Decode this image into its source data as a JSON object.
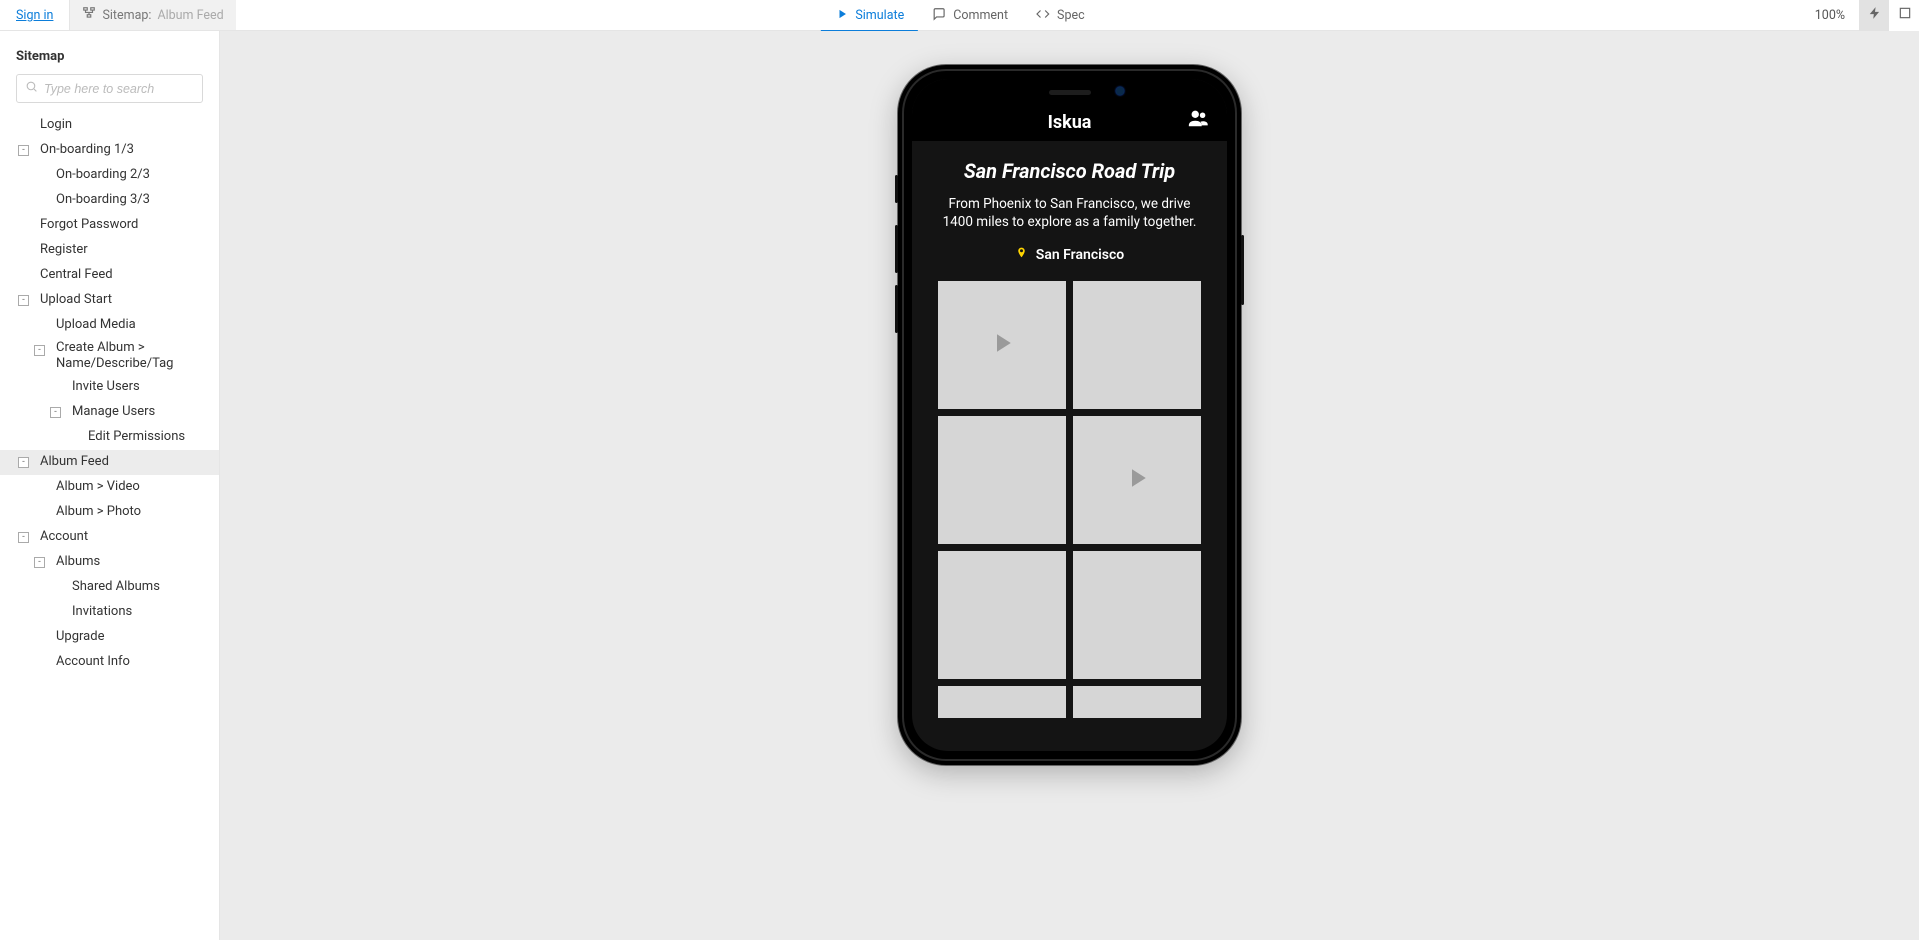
{
  "topbar": {
    "signin": "Sign in",
    "sitemap_prefix": "Sitemap:",
    "sitemap_page": "Album Feed",
    "tabs": {
      "simulate": "Simulate",
      "comment": "Comment",
      "spec": "Spec"
    },
    "zoom": "100%"
  },
  "sidebar": {
    "title": "Sitemap",
    "search_placeholder": "Type here to search",
    "tree": [
      {
        "label": "Login",
        "level": 0
      },
      {
        "label": "On-boarding 1/3",
        "level": 0,
        "expander": "-"
      },
      {
        "label": "On-boarding 2/3",
        "level": 1
      },
      {
        "label": "On-boarding 3/3",
        "level": 1
      },
      {
        "label": "Forgot Password",
        "level": 0
      },
      {
        "label": "Register",
        "level": 0
      },
      {
        "label": "Central Feed",
        "level": 0
      },
      {
        "label": "Upload Start",
        "level": 0,
        "expander": "-"
      },
      {
        "label": "Upload Media",
        "level": 1
      },
      {
        "label": "Create Album > Name/Describe/Tag",
        "level": 1,
        "expander": "-"
      },
      {
        "label": "Invite Users",
        "level": 2
      },
      {
        "label": "Manage Users",
        "level": 2,
        "expander": "-"
      },
      {
        "label": "Edit Permissions",
        "level": 3
      },
      {
        "label": "Album Feed",
        "level": 0,
        "expander": "-",
        "selected": true
      },
      {
        "label": "Album > Video",
        "level": 1
      },
      {
        "label": "Album > Photo",
        "level": 1
      },
      {
        "label": "Account",
        "level": 0,
        "expander": "-"
      },
      {
        "label": "Albums",
        "level": 1,
        "expander": "-"
      },
      {
        "label": "Shared Albums",
        "level": 2
      },
      {
        "label": "Invitations",
        "level": 2
      },
      {
        "label": "Upgrade",
        "level": 1
      },
      {
        "label": "Account Info",
        "level": 1
      }
    ]
  },
  "preview": {
    "brand": "Iskua",
    "title": "San Francisco Road Trip",
    "description": "From Phoenix to San Francisco, we drive 1400 miles to explore as a family together.",
    "location": "San Francisco",
    "cells": [
      {
        "type": "video"
      },
      {
        "type": "photo"
      },
      {
        "type": "photo"
      },
      {
        "type": "video"
      },
      {
        "type": "photo"
      },
      {
        "type": "photo"
      },
      {
        "type": "photo",
        "short": true
      },
      {
        "type": "photo",
        "short": true
      }
    ]
  }
}
